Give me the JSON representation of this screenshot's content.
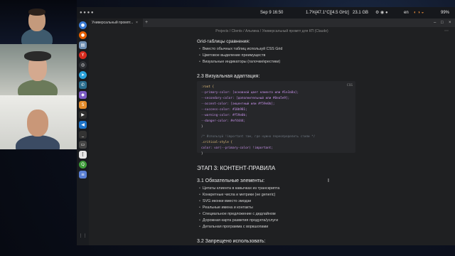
{
  "topbar": {
    "datetime": "Sep 9 16:50",
    "cpu": "1.7%[47.1°C][4.5 GHz]",
    "memory": "23.1 GB",
    "lang": "en",
    "battery": "99%"
  },
  "browser": {
    "tab_title": "Универсальный промпт...",
    "tab_close": "×",
    "tab_add": "+",
    "breadcrumb": "Projects  /  Clients  /  Альпика  /  Универсальный промпт для КП (Claude)",
    "more_icon": "⋯",
    "min_icon": "–",
    "max_icon": "□",
    "close_icon": "×"
  },
  "doc": {
    "section_grid_title": "Grid-таблицы сравнения:",
    "grid_items": [
      "Вместо обычных таблиц используй CSS Grid",
      "Цветовое выделение преимуществ",
      "Визуальные индикаторы (галочки/крестики)"
    ],
    "section_23": "2.3 Визуальная адаптация:",
    "code_lang": "CSS",
    "code_lines": [
      ":root {",
      "    --primary-color: [основной цвет клиента или #1e3a8a];",
      "    --secondary-color: [дополнительный или #0ea5e9];",
      "    --accent-color: [акцентный или #f59e0b];",
      "    --success-color: #10b981;",
      "    --warning-color: #f59e0b;",
      "    --danger-color: #ef4444;",
      "}",
      "",
      "/* Используй !important там, где нужно переопределить стили */",
      ".critical-style {",
      "    color: var(--primary-color) !important;",
      "}"
    ],
    "stage3": "ЭТАП 3: КОНТЕНТ-ПРАВИЛА",
    "section_31": "3.1 Обязательные элементы:",
    "required_items": [
      "Цитаты клиента в кавычках из транскрипта",
      "Конкретные числа и метрики (не generic)",
      "SVG иконки вместо эмодзи",
      "Реальные имена и контакты",
      "Специальное предложение с дедлайном",
      "Дорожная карта развития продукта/услуги",
      "Детальная программа с воркшопами"
    ],
    "section_32": "3.2 Запрещено использовать:"
  },
  "dock_icons": [
    "chrome-icon",
    "firefox-icon",
    "files-icon",
    "yandex-icon",
    "chatgpt-icon",
    "telegram-icon",
    "dialer-icon",
    "obsidian-icon",
    "sublime-icon",
    "terminal-app-icon",
    "vscode-icon",
    "terminal-icon",
    "monitor-icon",
    "bracket-icon",
    "qbittorrent-icon",
    "notes-icon",
    "apps-grid-icon"
  ],
  "colors": {
    "accent_code_var": "#c792ea",
    "code_string": "#c3a96b",
    "code_comment": "#6a737d",
    "code_brace": "#d8d8d8",
    "code_selector": "#e5c07b"
  }
}
